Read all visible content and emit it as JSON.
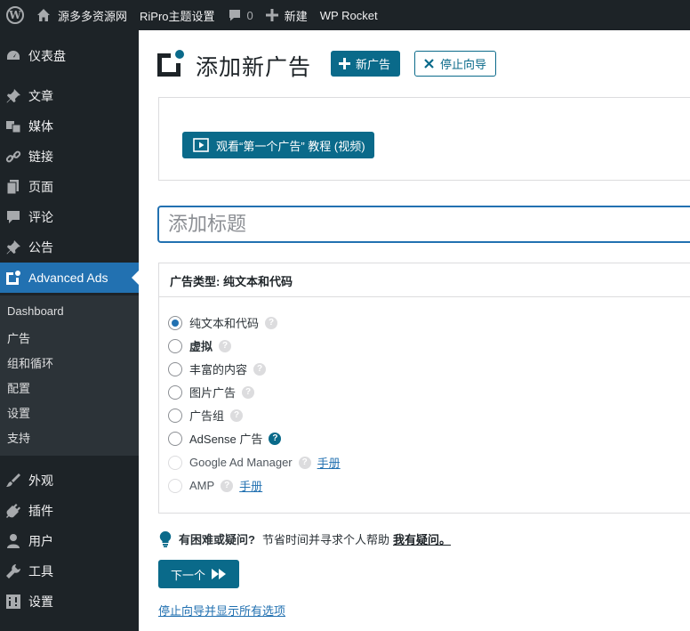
{
  "adminbar": {
    "site_name": "源多多资源网",
    "theme_settings": "RiPro主题设置",
    "comments_count": "0",
    "new_label": "新建",
    "wp_rocket": "WP Rocket"
  },
  "sidebar": {
    "items": [
      {
        "label": "仪表盘",
        "icon": "dashboard-icon"
      },
      {
        "label": "文章",
        "icon": "pin-icon"
      },
      {
        "label": "媒体",
        "icon": "media-icon"
      },
      {
        "label": "链接",
        "icon": "link-icon"
      },
      {
        "label": "页面",
        "icon": "page-icon"
      },
      {
        "label": "评论",
        "icon": "comment-icon"
      },
      {
        "label": "公告",
        "icon": "pin-icon"
      },
      {
        "label": "Advanced Ads",
        "icon": "advanced-ads-icon"
      },
      {
        "label": "外观",
        "icon": "brush-icon"
      },
      {
        "label": "插件",
        "icon": "plugin-icon"
      },
      {
        "label": "用户",
        "icon": "user-icon"
      },
      {
        "label": "工具",
        "icon": "wrench-icon"
      },
      {
        "label": "设置",
        "icon": "settings-icon"
      }
    ],
    "submenu": [
      "Dashboard",
      "广告",
      "组和循环",
      "配置",
      "设置",
      "支持"
    ]
  },
  "main": {
    "page_title": "添加新广告",
    "new_ad_button": "新广告",
    "stop_wizard_button": "停止向导",
    "video_button": "观看“第一个广告” 教程 (视频)",
    "title_placeholder": "添加标题",
    "ad_type_heading": "广告类型: 纯文本和代码",
    "ad_types": [
      {
        "label": "纯文本和代码",
        "checked": true
      },
      {
        "label": "虚拟",
        "checked": false
      },
      {
        "label": "丰富的内容",
        "checked": false
      },
      {
        "label": "图片广告",
        "checked": false
      },
      {
        "label": "广告组",
        "checked": false
      },
      {
        "label": "AdSense 广告",
        "checked": false
      },
      {
        "label": "Google Ad Manager",
        "checked": false,
        "link": "手册"
      },
      {
        "label": "AMP",
        "checked": false,
        "link": "手册"
      }
    ],
    "help_question": "有困难或疑问?",
    "help_text": "节省时间并寻求个人帮助",
    "help_link": "我有疑问。",
    "next_button": "下一个",
    "stop_and_show_link": "停止向导并显示所有选项"
  },
  "colors": {
    "adminbar_bg": "#1d2327",
    "active_menu": "#2271b1",
    "primary_button": "#0a6a8a",
    "link": "#2271b1"
  }
}
